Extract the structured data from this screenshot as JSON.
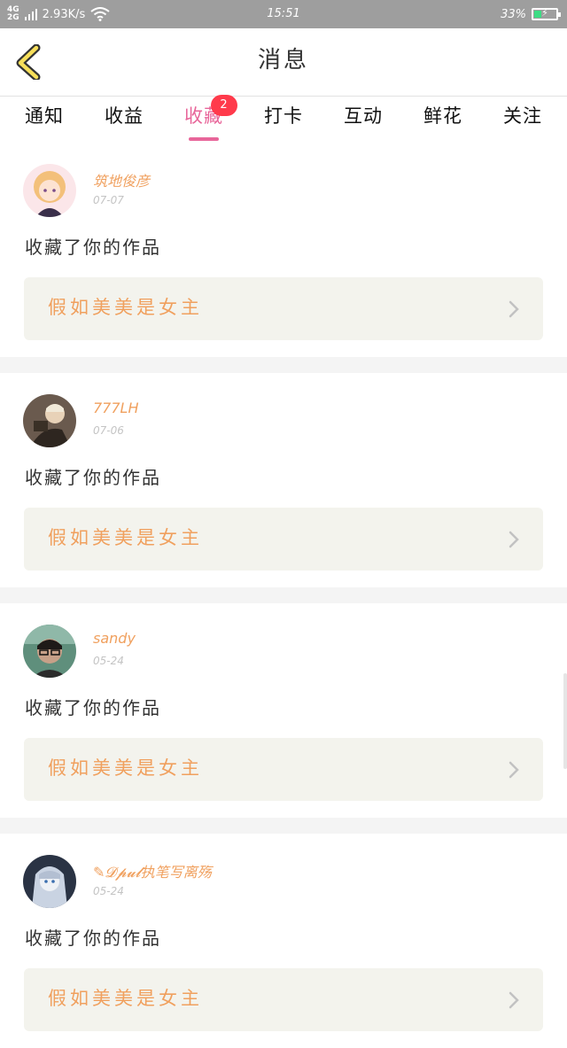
{
  "status_bar": {
    "network_top": "4G",
    "network_bottom": "2G",
    "speed": "2.93K/s",
    "time": "15:51",
    "battery": "33%",
    "battery_level": 0.33
  },
  "header": {
    "title": "消息"
  },
  "tabs": [
    {
      "label": "通知"
    },
    {
      "label": "收益"
    },
    {
      "label": "收藏",
      "badge": "2"
    },
    {
      "label": "打卡"
    },
    {
      "label": "互动"
    },
    {
      "label": "鲜花"
    },
    {
      "label": "关注"
    }
  ],
  "notifications": [
    {
      "username": "筑地俊彦",
      "date": "07-07",
      "action": "收藏了你的作品",
      "work_title": "假如美美是女主"
    },
    {
      "username": "777LH",
      "date": "07-06",
      "action": "收藏了你的作品",
      "work_title": "假如美美是女主"
    },
    {
      "username": "sandy",
      "date": "05-24",
      "action": "收藏了你的作品",
      "work_title": "假如美美是女主"
    },
    {
      "username": "✎𝓓𝓹𝓾𝓵执笔写离殇",
      "date": "05-24",
      "action": "收藏了你的作品",
      "work_title": "假如美美是女主"
    }
  ],
  "colors": {
    "accent_pink": "#e8669a",
    "username_orange": "#f0a05e",
    "badge_red": "#ff3a4b",
    "card_bg": "#f3f3ed",
    "status_bar_bg": "#9e9e9e"
  }
}
